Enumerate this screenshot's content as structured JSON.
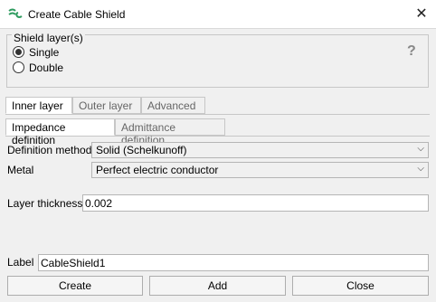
{
  "window": {
    "title": "Create Cable Shield"
  },
  "shield_layers": {
    "legend": "Shield layer(s)",
    "options": [
      {
        "label": "Single",
        "selected": true
      },
      {
        "label": "Double",
        "selected": false
      }
    ],
    "help": "?"
  },
  "outer_tabs": [
    {
      "label": "Inner layer",
      "active": true
    },
    {
      "label": "Outer layer",
      "active": false
    },
    {
      "label": "Advanced",
      "active": false
    }
  ],
  "inner_tabs": [
    {
      "label": "Impedance definition",
      "active": true
    },
    {
      "label": "Admittance definition",
      "active": false
    }
  ],
  "definition": {
    "method_label": "Definition method",
    "method_value": "Solid (Schelkunoff)",
    "metal_label": "Metal",
    "metal_value": "Perfect electric conductor"
  },
  "thickness": {
    "label": "Layer thickness",
    "value": "0.002"
  },
  "name": {
    "label": "Label",
    "value": "CableShield1"
  },
  "buttons": {
    "create": "Create",
    "add": "Add",
    "close": "Close"
  },
  "colors": {
    "accent": "#2e9b5f"
  }
}
